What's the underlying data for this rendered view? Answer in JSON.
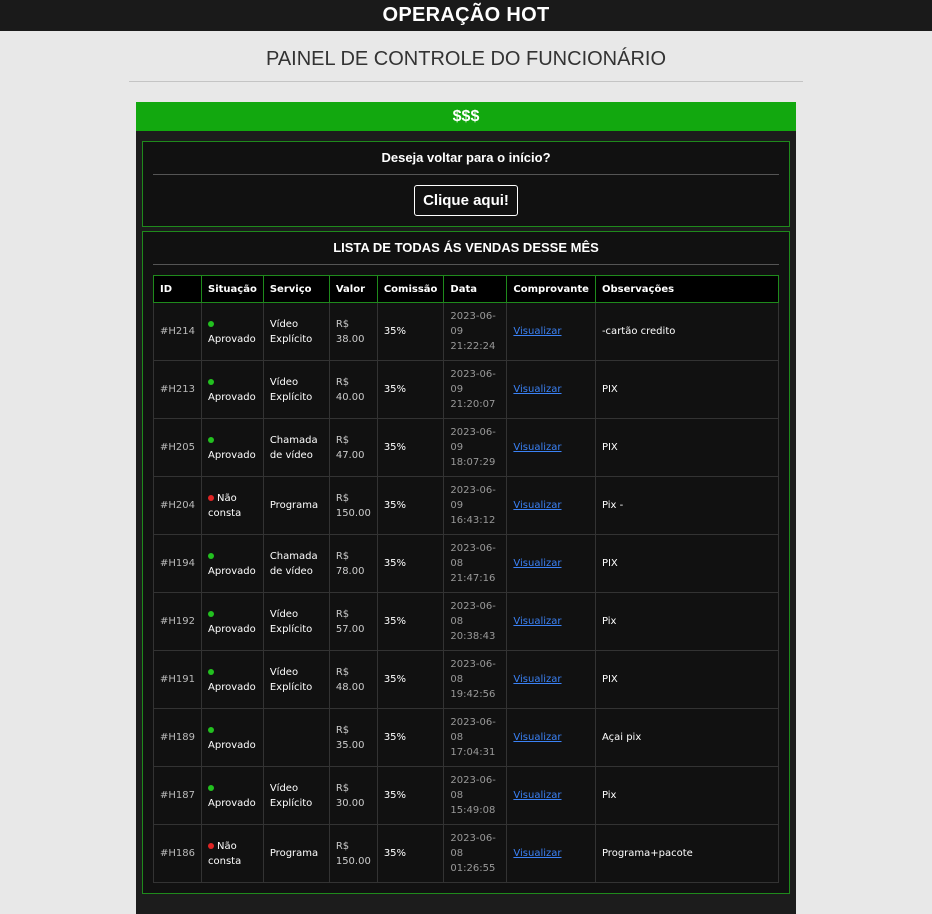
{
  "app": {
    "title": "OPERAÇÃO HOT"
  },
  "page": {
    "title": "PAINEL DE CONTROLE DO FUNCIONÁRIO"
  },
  "panel": {
    "header": "$$$"
  },
  "back_box": {
    "title": "Deseja voltar para o início?",
    "button": "Clique aqui!"
  },
  "sales": {
    "title": "LISTA DE TODAS ÁS VENDAS DESSE MÊS",
    "columns": [
      "ID",
      "Situação",
      "Serviço",
      "Valor",
      "Comissão",
      "Data",
      "Comprovante",
      "Observações"
    ],
    "status_colors": {
      "Aprovado": "#22c01f",
      "Não consta": "#e02424"
    },
    "rows": [
      {
        "id": "#H214",
        "status": "Aprovado",
        "service": "Vídeo Explícito",
        "value": "R$ 38.00",
        "commission": "35%",
        "date": "2023-06-09 21:22:24",
        "receipt": "Visualizar",
        "notes": "-cartão credito"
      },
      {
        "id": "#H213",
        "status": "Aprovado",
        "service": "Vídeo Explícito",
        "value": "R$ 40.00",
        "commission": "35%",
        "date": "2023-06-09 21:20:07",
        "receipt": "Visualizar",
        "notes": "PIX"
      },
      {
        "id": "#H205",
        "status": "Aprovado",
        "service": "Chamada de vídeo",
        "value": "R$ 47.00",
        "commission": "35%",
        "date": "2023-06-09 18:07:29",
        "receipt": "Visualizar",
        "notes": "PIX"
      },
      {
        "id": "#H204",
        "status": "Não consta",
        "service": "Programa",
        "value": "R$ 150.00",
        "commission": "35%",
        "date": "2023-06-09 16:43:12",
        "receipt": "Visualizar",
        "notes": "Pix -"
      },
      {
        "id": "#H194",
        "status": "Aprovado",
        "service": "Chamada de vídeo",
        "value": "R$ 78.00",
        "commission": "35%",
        "date": "2023-06-08 21:47:16",
        "receipt": "Visualizar",
        "notes": "PIX"
      },
      {
        "id": "#H192",
        "status": "Aprovado",
        "service": "Vídeo Explícito",
        "value": "R$ 57.00",
        "commission": "35%",
        "date": "2023-06-08 20:38:43",
        "receipt": "Visualizar",
        "notes": "Pix"
      },
      {
        "id": "#H191",
        "status": "Aprovado",
        "service": "Vídeo Explícito",
        "value": "R$ 48.00",
        "commission": "35%",
        "date": "2023-06-08 19:42:56",
        "receipt": "Visualizar",
        "notes": "PIX"
      },
      {
        "id": "#H189",
        "status": "Aprovado",
        "service": "",
        "value": "R$ 35.00",
        "commission": "35%",
        "date": "2023-06-08 17:04:31",
        "receipt": "Visualizar",
        "notes": "Açai pix"
      },
      {
        "id": "#H187",
        "status": "Aprovado",
        "service": "Vídeo Explícito",
        "value": "R$ 30.00",
        "commission": "35%",
        "date": "2023-06-08 15:49:08",
        "receipt": "Visualizar",
        "notes": "Pix"
      },
      {
        "id": "#H186",
        "status": "Não consta",
        "service": "Programa",
        "value": "R$ 150.00",
        "commission": "35%",
        "date": "2023-06-08 01:26:55",
        "receipt": "Visualizar",
        "notes": "Programa+pacote"
      }
    ]
  }
}
